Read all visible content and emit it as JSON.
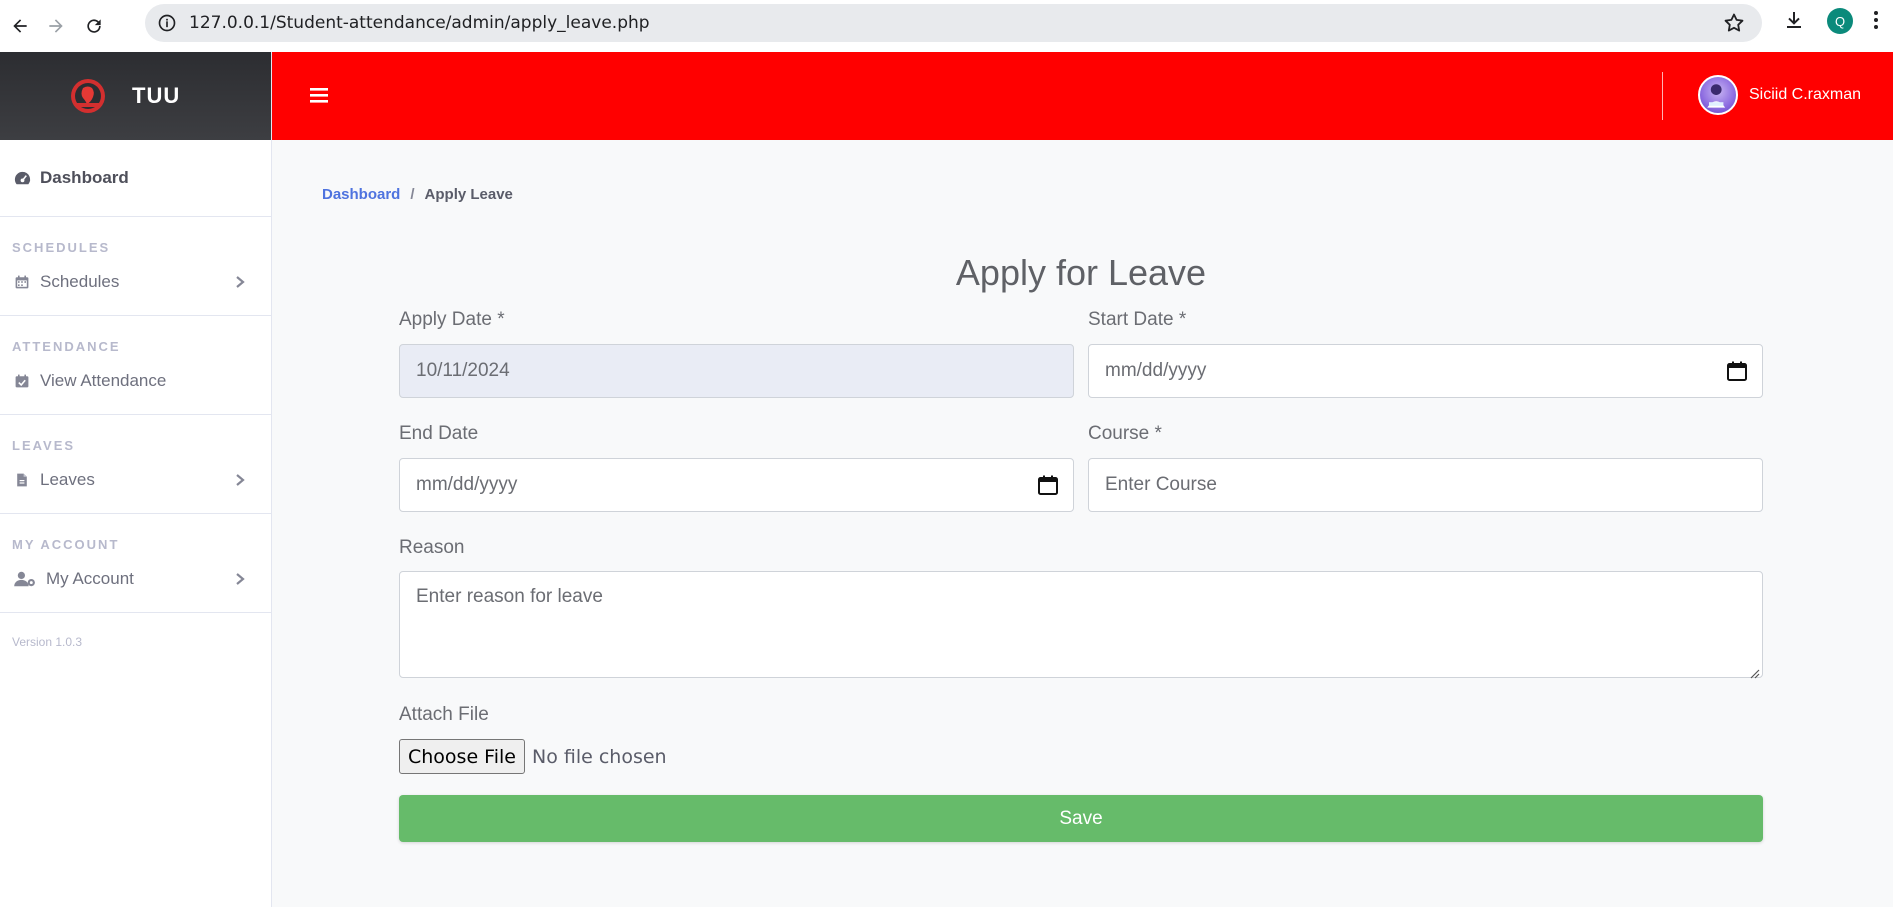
{
  "browser": {
    "url": "127.0.0.1/Student-attendance/admin/apply_leave.php",
    "profile_initial": "Q"
  },
  "brand": {
    "name": "TUU"
  },
  "user": {
    "name": "Siciid C.raxman"
  },
  "sidebar": {
    "dashboard": "Dashboard",
    "sections": [
      {
        "heading": "SCHEDULES",
        "item": "Schedules",
        "icon": "calendar-icon"
      },
      {
        "heading": "ATTENDANCE",
        "item": "View Attendance",
        "icon": "calendar-check-icon"
      },
      {
        "heading": "LEAVES",
        "item": "Leaves",
        "icon": "file-icon"
      },
      {
        "heading": "MY ACCOUNT",
        "item": "My Account",
        "icon": "user-gear-icon"
      }
    ],
    "version": "Version 1.0.3"
  },
  "breadcrumb": {
    "parent": "Dashboard",
    "separator": "/",
    "current": "Apply Leave"
  },
  "form": {
    "title": "Apply for Leave",
    "apply_date": {
      "label": "Apply Date *",
      "value": "10/11/2024"
    },
    "start_date": {
      "label": "Start Date *",
      "placeholder": "mm/dd/yyyy"
    },
    "end_date": {
      "label": "End Date",
      "placeholder": "mm/dd/yyyy"
    },
    "course": {
      "label": "Course *",
      "placeholder": "Enter Course"
    },
    "reason": {
      "label": "Reason",
      "placeholder": "Enter reason for leave"
    },
    "attach": {
      "label": "Attach File",
      "button": "Choose File",
      "status": "No file chosen"
    },
    "save": "Save"
  },
  "colors": {
    "topbar": "#ff0000",
    "save": "#66bb6a",
    "link": "#4e73df"
  }
}
